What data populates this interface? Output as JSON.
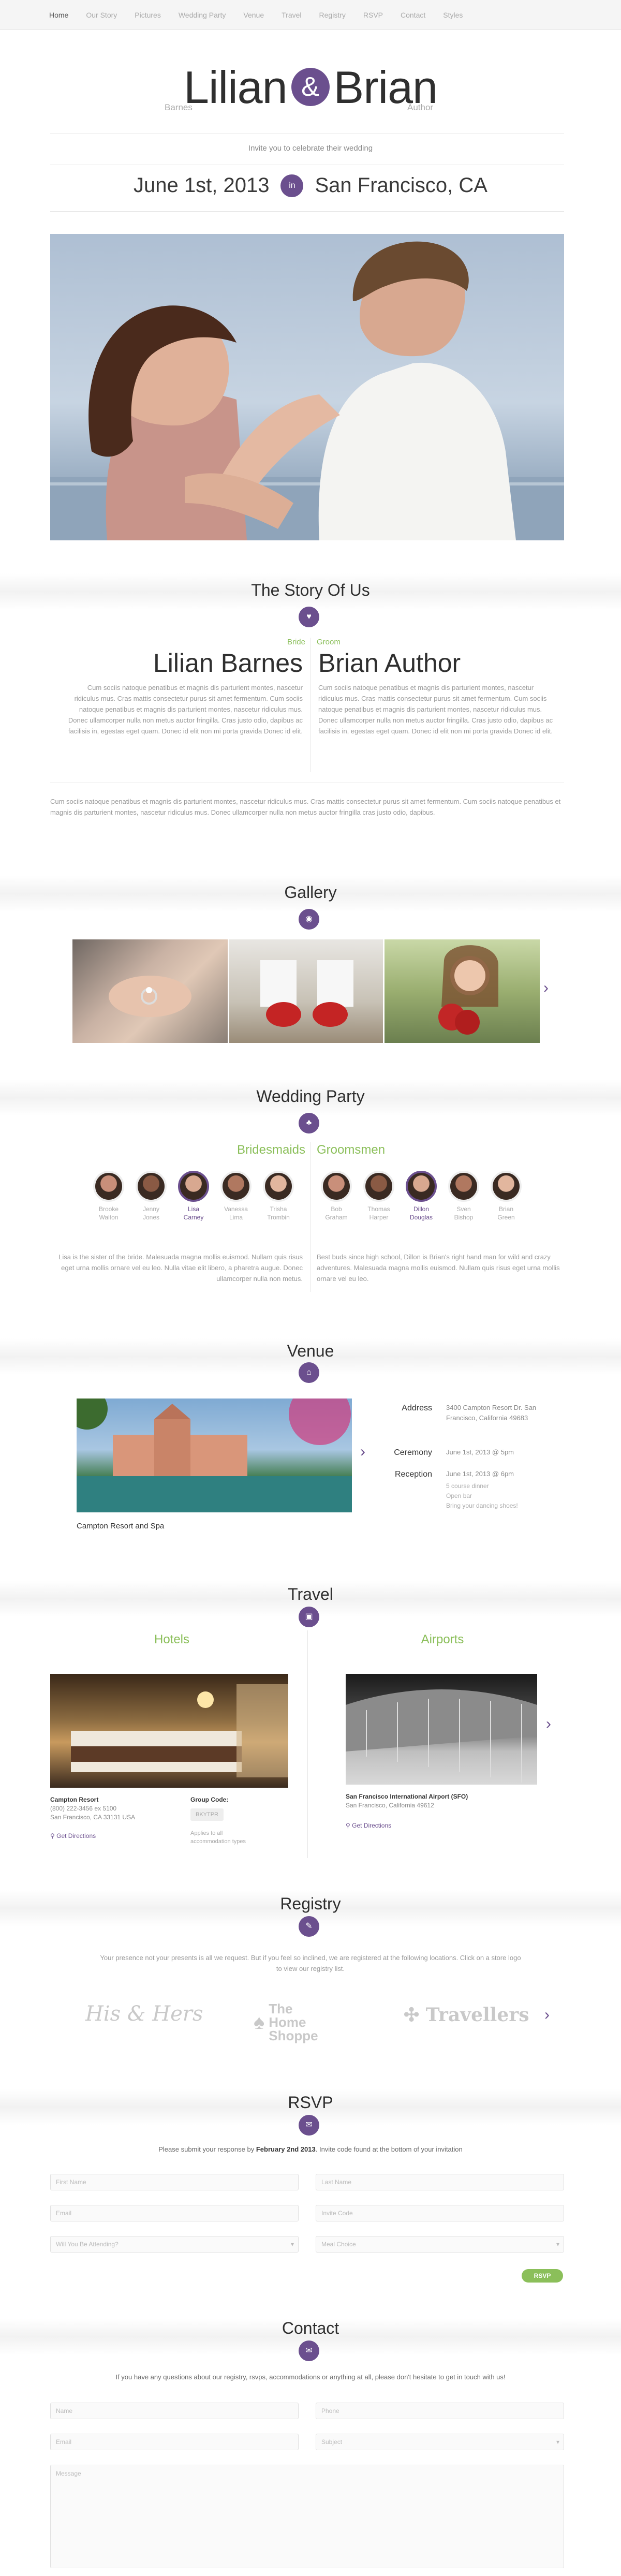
{
  "nav": [
    "Home",
    "Our Story",
    "Pictures",
    "Wedding Party",
    "Venue",
    "Travel",
    "Registry",
    "RSVP",
    "Contact",
    "Styles"
  ],
  "header": {
    "bride_first": "Lilian",
    "groom_first": "Brian",
    "amp": "&",
    "bride_last": "Barnes",
    "groom_last": "Author",
    "invite": "Invite you to celebrate their wedding",
    "date": "June 1st, 2013",
    "in": "in",
    "location": "San Francisco, CA"
  },
  "story": {
    "title": "The Story Of Us",
    "bride_label": "Bride",
    "groom_label": "Groom",
    "bride_name": "Lilian Barnes",
    "groom_name": "Brian Author",
    "bride_text": "Cum sociis natoque penatibus et magnis dis parturient montes, nascetur ridiculus mus. Cras mattis consectetur purus sit amet fermentum. Cum sociis natoque penatibus et magnis dis parturient montes, nascetur ridiculus mus. Donec ullamcorper nulla non metus auctor fringilla. Cras justo odio, dapibus ac facilisis in, egestas eget quam. Donec id elit non mi porta gravida Donec id elit.",
    "groom_text": "Cum sociis natoque penatibus et magnis dis parturient montes, nascetur ridiculus mus. Cras mattis consectetur purus sit amet fermentum. Cum sociis natoque penatibus et magnis dis parturient montes, nascetur ridiculus mus. Donec ullamcorper nulla non metus auctor fringilla. Cras justo odio, dapibus ac facilisis in, egestas eget quam. Donec id elit non mi porta gravida Donec id elit.",
    "shared_text": "Cum sociis natoque penatibus et magnis dis parturient montes, nascetur ridiculus mus. Cras mattis consectetur purus sit amet fermentum. Cum sociis natoque penatibus et magnis dis parturient montes, nascetur ridiculus mus. Donec ullamcorper nulla non metus auctor fringilla cras justo odio, dapibus."
  },
  "gallery": {
    "title": "Gallery"
  },
  "party": {
    "title": "Wedding Party",
    "bridesmaids_label": "Bridesmaids",
    "groomsmen_label": "Groomsmen",
    "bridesmaids": [
      [
        "Brooke",
        "Walton"
      ],
      [
        "Jenny",
        "Jones"
      ],
      [
        "Lisa",
        "Carney"
      ],
      [
        "Vanessa",
        "Lima"
      ],
      [
        "Trisha",
        "Trombin"
      ]
    ],
    "groomsmen": [
      [
        "Bob",
        "Graham"
      ],
      [
        "Thomas",
        "Harper"
      ],
      [
        "Dillon",
        "Douglas"
      ],
      [
        "Sven",
        "Bishop"
      ],
      [
        "Brian",
        "Green"
      ]
    ],
    "bridesmaids_text": "Lisa is the sister of the bride. Malesuada magna mollis euismod. Nullam quis risus eget urna mollis ornare vel eu leo. Nulla vitae elit libero, a pharetra augue. Donec ullamcorper nulla non metus.",
    "groomsmen_text": "Best buds since high school, Dillon is Brian's right hand man for wild and crazy adventures. Malesuada magna mollis euismod. Nullam quis risus eget urna mollis ornare vel eu leo."
  },
  "venue": {
    "title": "Venue",
    "caption": "Campton Resort and Spa",
    "address_label": "Address",
    "address": "3400 Campton Resort Dr. San Francisco, California 49683",
    "ceremony_label": "Ceremony",
    "ceremony": "June 1st, 2013 @ 5pm",
    "reception_label": "Reception",
    "reception": "June 1st, 2013 @ 6pm",
    "reception_notes": [
      "5 course dinner",
      "Open bar",
      "Bring your dancing shoes!"
    ]
  },
  "travel": {
    "title": "Travel",
    "hotels_label": "Hotels",
    "airports_label": "Airports",
    "hotel_name": "Campton Resort",
    "hotel_phone": "(800) 222-3456 ex 5100",
    "hotel_addr": "San Francisco, CA 33131 USA",
    "group_label": "Group Code:",
    "group_code": "BKYTPR",
    "group_note": "Applies to all accommodation types",
    "directions": "Get Directions",
    "airport_name": "San Francisco International Airport (SFO)",
    "airport_addr": "San Francisco, California 49612"
  },
  "registry": {
    "title": "Registry",
    "text": "Your presence not your presents is all we request. But if you feel so inclined, we are registered at the following locations. Click on a store logo to view our registry list.",
    "stores": [
      "His & Hers",
      "The Home Shoppe",
      "Travellers"
    ]
  },
  "rsvp": {
    "title": "RSVP",
    "text_pre": "Please submit your response by ",
    "deadline": "February 2nd 2013",
    "text_post": ". Invite code found at the bottom of your invitation",
    "first": "First Name",
    "last": "Last Name",
    "email": "Email",
    "code": "Invite Code",
    "attend": "Will You Be Attending?",
    "meal": "Meal Choice",
    "button": "RSVP"
  },
  "contact": {
    "title": "Contact",
    "text": "If you have any questions about our registry, rsvps, accommodations or anything at all, please don't hesitate to get in touch with us!",
    "name": "Name",
    "phone": "Phone",
    "email": "Email",
    "subject": "Subject",
    "message": "Message"
  }
}
